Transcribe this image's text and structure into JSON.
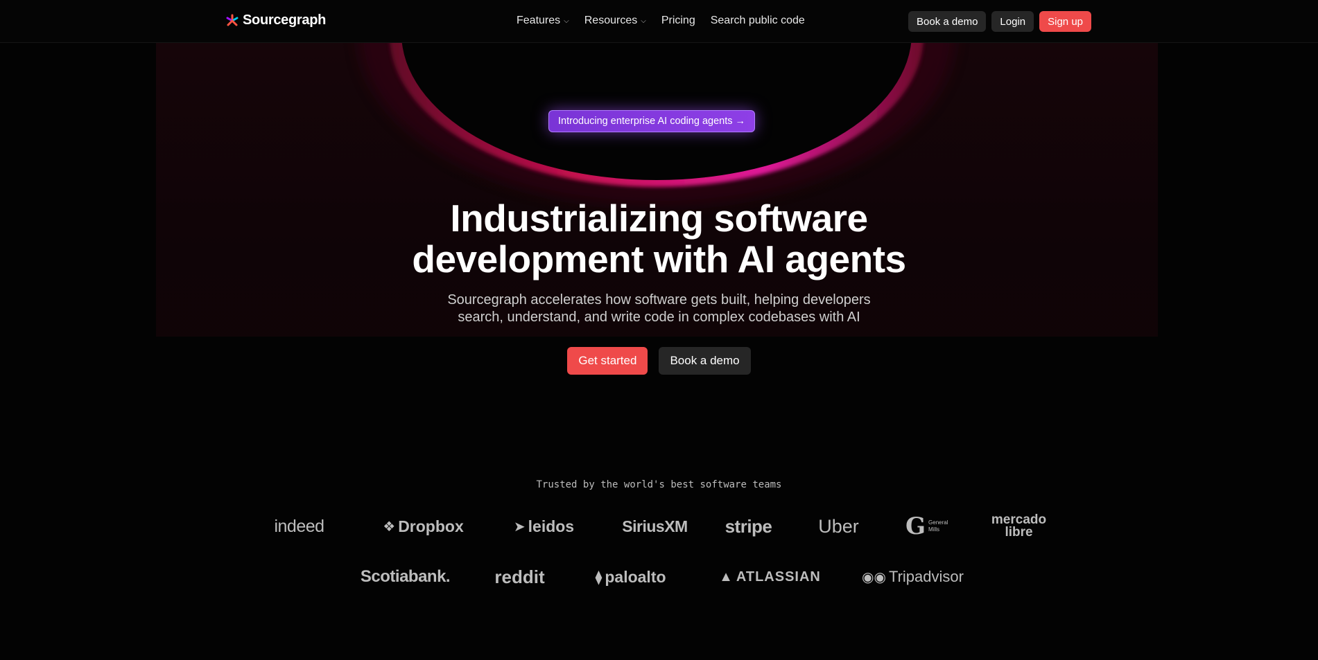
{
  "brand": {
    "name": "Sourcegraph",
    "accent": "#ef4a4a"
  },
  "nav": {
    "features": "Features",
    "resources": "Resources",
    "pricing": "Pricing",
    "search": "Search public code"
  },
  "header_buttons": {
    "demo": "Book a demo",
    "login": "Login",
    "signup": "Sign up"
  },
  "hero": {
    "badge": "Introducing enterprise AI coding agents →",
    "headline_line1": "Industrializing software",
    "headline_line2": "development with AI agents",
    "sub_line1": "Sourcegraph accelerates how software gets built, helping developers",
    "sub_line2": "search, understand, and write code in complex codebases with AI",
    "cta_primary": "Get started",
    "cta_secondary": "Book a demo"
  },
  "trusted": {
    "label": "Trusted by the world's best software teams",
    "row1": [
      "indeed",
      "Dropbox",
      "leidos",
      "SiriusXM",
      "stripe",
      "Uber",
      "General Mills",
      "mercado libre"
    ],
    "row2": [
      "Scotiabank.",
      "reddit",
      "paloalto",
      "ATLASSIAN",
      "Tripadvisor"
    ]
  }
}
